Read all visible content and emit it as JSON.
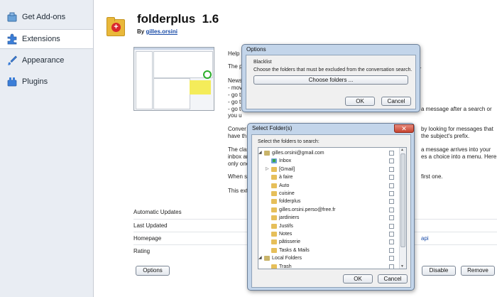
{
  "sidebar": {
    "items": [
      {
        "label": "Get Add-ons",
        "icon": "get-addons-icon"
      },
      {
        "label": "Extensions",
        "icon": "puzzle-piece-icon"
      },
      {
        "label": "Appearance",
        "icon": "paintbrush-icon"
      },
      {
        "label": "Plugins",
        "icon": "plugins-icon"
      }
    ],
    "selected": "Extensions"
  },
  "extension": {
    "name": "folderplus",
    "version": "1.6",
    "author_prefix": "By",
    "author": "gilles.orsini",
    "description_visible": {
      "l1": "Help",
      "l2": "The p",
      "l3": "News",
      "l4": "- mov",
      "l5": "- go t",
      "l6": "- go t",
      "l7": "- go t",
      "l8": "you u",
      "l9": "Conver",
      "l10": "have th",
      "l11": "The clas",
      "l12": "inbox ar",
      "l13": "only one",
      "l14": "When se",
      "l15": "This exte",
      "r1": "rs.",
      "r2": "a message after a search or",
      "r3": "by looking for messages that",
      "r4": "the subject's prefix.",
      "r5": "a message arrives into your",
      "r6": "es a choice into a menu. Here,",
      "r7": "first one.",
      "r8": "api"
    },
    "details": [
      {
        "label": "Automatic Updates"
      },
      {
        "label": "Last Updated"
      },
      {
        "label": "Homepage"
      },
      {
        "label": "Rating"
      }
    ],
    "buttons": {
      "options": "Options",
      "disable": "Disable",
      "remove": "Remove"
    }
  },
  "options_dialog": {
    "title": "Options",
    "group_label": "Blacklist",
    "description": "Choose the folders that must be excluded from the conversation search.",
    "choose_button": "Choose folders ...",
    "ok": "OK",
    "cancel": "Cancel"
  },
  "select_folder_dialog": {
    "title": "Select Folder(s)",
    "instruction": "Select the folders to search:",
    "folders": [
      {
        "name": "gilles.orsini@gmail.com",
        "level": 0,
        "expander": "◢",
        "type": "account",
        "checked": false
      },
      {
        "name": "Inbox",
        "level": 1,
        "expander": "",
        "type": "inbox",
        "checked": false
      },
      {
        "name": "[Gmail]",
        "level": 1,
        "expander": "▷",
        "type": "folder",
        "checked": false
      },
      {
        "name": "à faire",
        "level": 1,
        "expander": "",
        "type": "folder",
        "checked": false
      },
      {
        "name": "Auto",
        "level": 1,
        "expander": "",
        "type": "folder",
        "checked": false
      },
      {
        "name": "cuisine",
        "level": 1,
        "expander": "",
        "type": "folder",
        "checked": false
      },
      {
        "name": "folderplus",
        "level": 1,
        "expander": "",
        "type": "folder",
        "checked": false
      },
      {
        "name": "gilles.orsini.perso@free.fr",
        "level": 1,
        "expander": "",
        "type": "folder",
        "checked": false
      },
      {
        "name": "jardiniers",
        "level": 1,
        "expander": "",
        "type": "folder",
        "checked": false
      },
      {
        "name": "Justifs",
        "level": 1,
        "expander": "",
        "type": "folder",
        "checked": false
      },
      {
        "name": "Notes",
        "level": 1,
        "expander": "",
        "type": "folder",
        "checked": false
      },
      {
        "name": "pâtisserie",
        "level": 1,
        "expander": "",
        "type": "folder",
        "checked": false
      },
      {
        "name": "Tasks & Mails",
        "level": 1,
        "expander": "",
        "type": "folder",
        "checked": false
      },
      {
        "name": "Local Folders",
        "level": 0,
        "expander": "◢",
        "type": "account",
        "checked": false
      },
      {
        "name": "Trash",
        "level": 1,
        "expander": "",
        "type": "folder",
        "checked": false
      }
    ],
    "ok": "OK",
    "cancel": "Cancel"
  },
  "colors": {
    "sidebar_bg": "#e9edf3",
    "dialog_frame": "#c3d5ea",
    "link": "#1a4ca8",
    "close_button": "#c6432f"
  }
}
